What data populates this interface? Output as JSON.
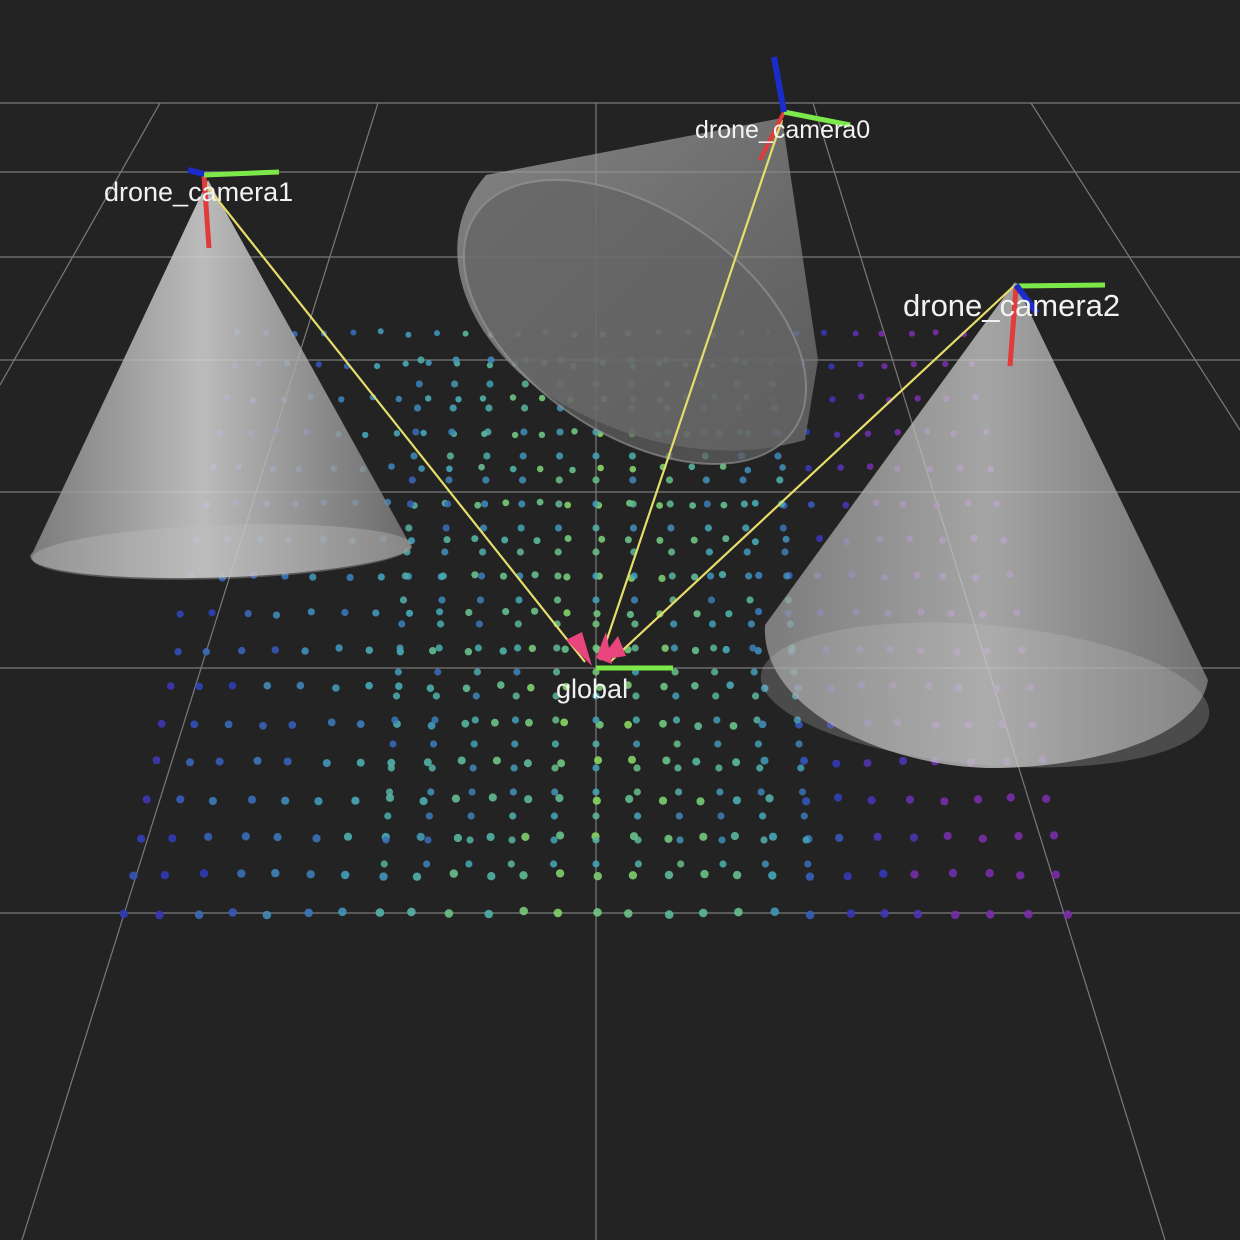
{
  "scene": {
    "background_color": "#232323",
    "grid_color": "#7a7a7a",
    "frames": {
      "global": "global",
      "camera0": "drone_camera0",
      "camera1": "drone_camera1",
      "camera2": "drone_camera2"
    },
    "axis_colors": {
      "x": "#e23b3b",
      "y": "#7de84a",
      "z": "#1c2ccc"
    },
    "frustum_color": "#bdbdbd",
    "link_color": "#e6dd6a",
    "arrow_head_color": "#e8457e",
    "point_cloud": {
      "colormap": [
        "#7a2ea8",
        "#2f38b8",
        "#46a9b8",
        "#8bd85f"
      ]
    }
  }
}
